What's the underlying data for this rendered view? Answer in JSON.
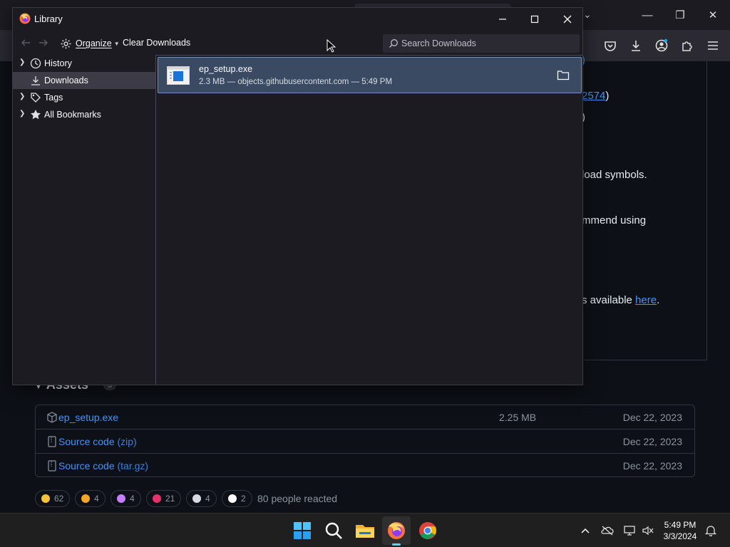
{
  "background_page": {
    "text_lines": [
      {
        "text": "load symbols."
      },
      {
        "text": "mmend using"
      },
      {
        "text": "s available "
      }
    ],
    "link_partial": "2574",
    "here_link": "here",
    "assets": {
      "heading": "Assets",
      "count": "3",
      "rows": [
        {
          "name": "ep_setup.exe",
          "suffix": "",
          "size": "2.25 MB",
          "date": "Dec 22, 2023"
        },
        {
          "name": "Source code",
          "suffix": " (zip)",
          "size": "",
          "date": "Dec 22, 2023"
        },
        {
          "name": "Source code",
          "suffix": " (tar.gz)",
          "size": "",
          "date": "Dec 22, 2023"
        }
      ]
    },
    "reactions": [
      {
        "emoji": "thumbs-up",
        "count": "62"
      },
      {
        "emoji": "laugh",
        "count": "4"
      },
      {
        "emoji": "hooray",
        "count": "4"
      },
      {
        "emoji": "heart",
        "count": "21"
      },
      {
        "emoji": "rocket",
        "count": "4"
      },
      {
        "emoji": "eyes",
        "count": "2"
      }
    ],
    "reacted_text": "80 people reacted"
  },
  "library": {
    "title": "Library",
    "toolbar": {
      "organize_label": "Organize",
      "clear_label": "Clear Downloads",
      "search_placeholder": "Search Downloads"
    },
    "sidebar": {
      "items": [
        {
          "label": "History",
          "icon": "clock-icon",
          "expandable": true,
          "selected": false
        },
        {
          "label": "Downloads",
          "icon": "download-icon",
          "expandable": false,
          "selected": true
        },
        {
          "label": "Tags",
          "icon": "tag-icon",
          "expandable": true,
          "selected": false
        },
        {
          "label": "All Bookmarks",
          "icon": "star-icon",
          "expandable": true,
          "selected": false
        }
      ]
    },
    "downloads": [
      {
        "name": "ep_setup.exe",
        "meta": "2.3 MB — objects.githubusercontent.com — 5:49 PM"
      }
    ]
  },
  "taskbar": {
    "clock_time": "5:49 PM",
    "clock_date": "3/3/2024",
    "apps": [
      "start-icon",
      "search-icon",
      "file-explorer-icon",
      "firefox-icon",
      "chrome-icon"
    ]
  },
  "colors": {
    "accent_link": "#4493f8",
    "selection": "#3a4a63",
    "taskbar_indicator": "#60cdff"
  }
}
